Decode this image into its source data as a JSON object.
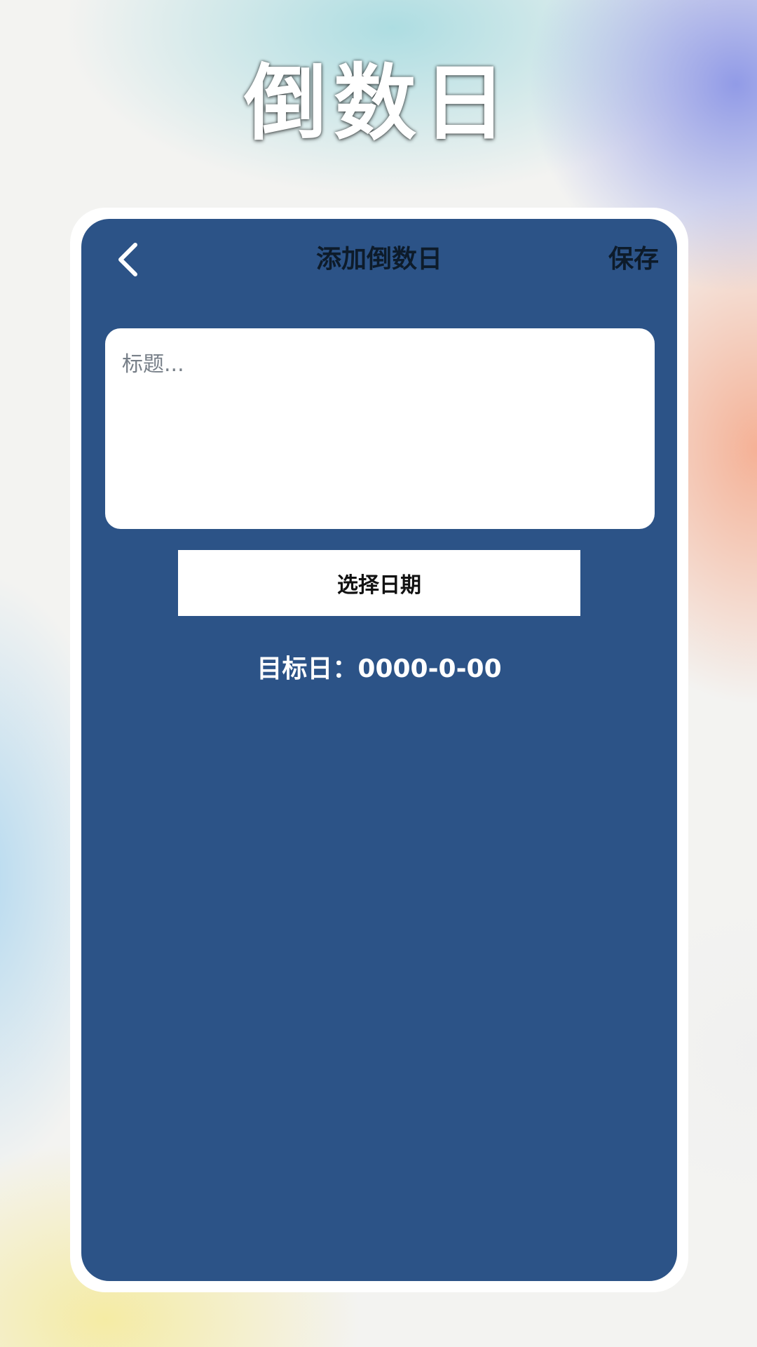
{
  "hero": {
    "title": "倒数日"
  },
  "nav": {
    "back_icon": "chevron-left-icon",
    "title": "添加倒数日",
    "save_label": "保存"
  },
  "form": {
    "title_placeholder": "标题...",
    "title_value": "",
    "date_button_label": "选择日期",
    "target_label": "目标日：",
    "target_value": "0000-0-00"
  },
  "colors": {
    "screen_bg": "#2c5387",
    "frame": "#ffffff",
    "nav_text": "#0d1b2a",
    "target_text": "#ffffff"
  }
}
